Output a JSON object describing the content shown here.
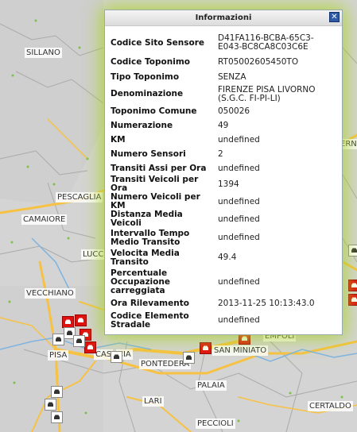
{
  "map": {
    "places": [
      {
        "name": "SILLANO"
      },
      {
        "name": "PESCAGLIA"
      },
      {
        "name": "CAMAIORE"
      },
      {
        "name": "LUCC"
      },
      {
        "name": "VECCHIANO"
      },
      {
        "name": "PISA"
      },
      {
        "name": "CAS"
      },
      {
        "name": "CIA"
      },
      {
        "name": "PONTEDERA"
      },
      {
        "name": "SAN MINIATO"
      },
      {
        "name": "EMPOLI"
      },
      {
        "name": "PALAIA"
      },
      {
        "name": "LARI"
      },
      {
        "name": "CERTALDO"
      },
      {
        "name": "PECCIOLI"
      },
      {
        "name": "ERNO"
      }
    ],
    "colors": {
      "background": "#d4d4d4",
      "roads": "#f7c243",
      "rivers": "#7fb4e0",
      "borders": "#aaaaaa",
      "sensor": "#e01010"
    }
  },
  "popup": {
    "title": "Informazioni",
    "close_icon": "close-icon",
    "glow_color": "#aad228",
    "rows": [
      {
        "key": "Codice Sito Sensore",
        "value": "D41FA116-BCBA-65C3-E043-BC8CA8C03C6E"
      },
      {
        "key": "Codice Toponimo",
        "value": "RT05002605450TO"
      },
      {
        "key": "Tipo Toponimo",
        "value": "SENZA"
      },
      {
        "key": "Denominazione",
        "value": "FIRENZE PISA LIVORNO (S.G.C. FI-PI-LI)"
      },
      {
        "key": "Toponimo Comune",
        "value": "050026"
      },
      {
        "key": "Numerazione",
        "value": "49"
      },
      {
        "key": "KM",
        "value": "undefined"
      },
      {
        "key": "Numero Sensori",
        "value": "2"
      },
      {
        "key": "Transiti Assi per Ora",
        "value": "undefined"
      },
      {
        "key": "Transiti Veicoli per Ora",
        "value": "1394"
      },
      {
        "key": "Numero Veicoli per KM",
        "value": "undefined"
      },
      {
        "key": "Distanza Media Veicoli",
        "value": "undefined"
      },
      {
        "key": "Intervallo Tempo Medio Transito",
        "value": "undefined"
      },
      {
        "key": "Velocita Media Transito",
        "value": "49.4"
      },
      {
        "key": "Percentuale Occupazione carreggiata",
        "value": "undefined"
      },
      {
        "key": "Ora Rilevamento",
        "value": "2013-11-25 10:13:43.0"
      },
      {
        "key": "Codice Elemento Stradale",
        "value": "undefined"
      }
    ]
  }
}
